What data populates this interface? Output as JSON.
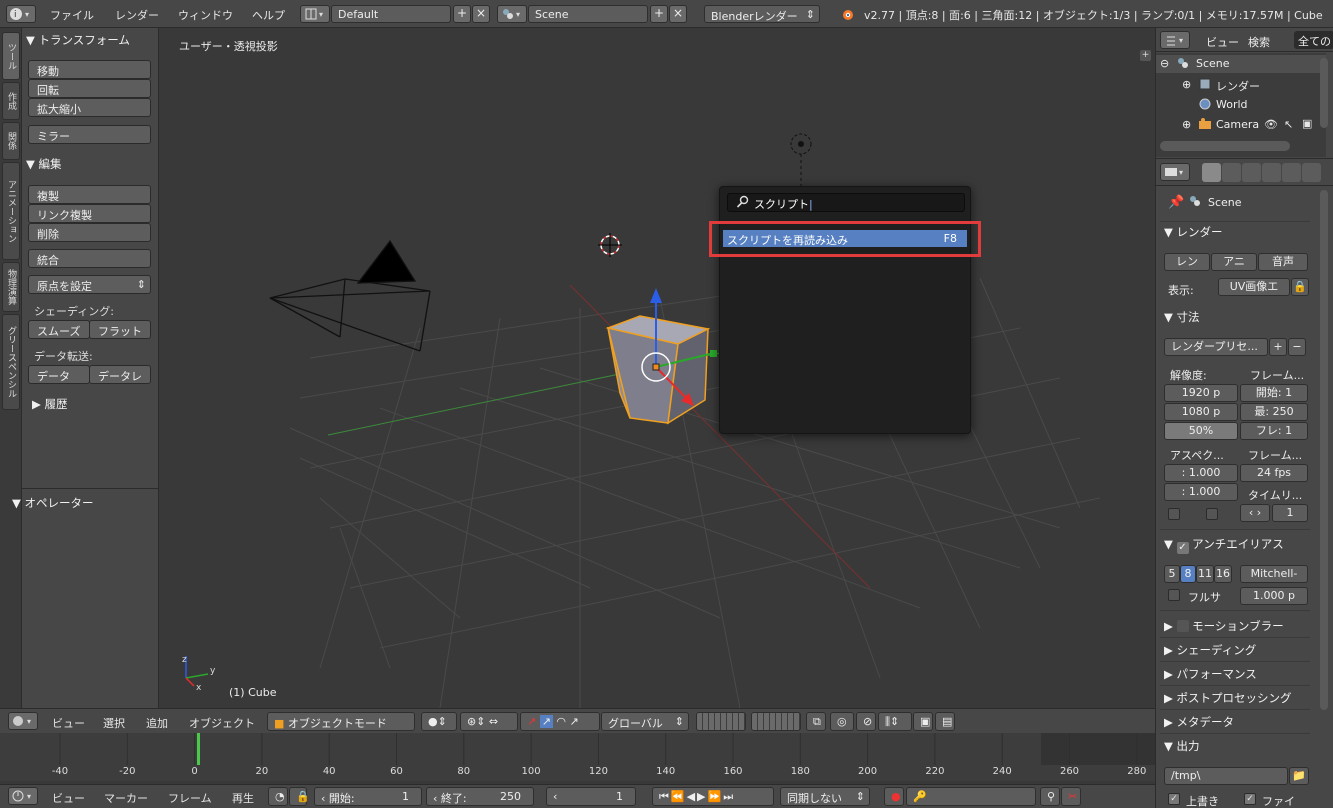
{
  "topbar": {
    "menus": [
      "ファイル",
      "レンダー",
      "ウィンドウ",
      "ヘルプ"
    ],
    "layout": "Default",
    "scene": "Scene",
    "engine": "Blenderレンダー",
    "stats": "v2.77 | 頂点:8 | 面:6 | 三角面:12 | オブジェクト:1/3 | ランプ:0/1 | メモリ:17.57M | Cube"
  },
  "left_tabs": [
    "ツール",
    "作成",
    "関係",
    "アニメーション",
    "物理演算",
    "グリースペンシル"
  ],
  "toolshelf": {
    "transform_header": "▼ トランスフォーム",
    "move": "移動",
    "rotate": "回転",
    "scale": "拡大縮小",
    "mirror": "ミラー",
    "edit_header": "▼ 編集",
    "duplicate": "複製",
    "link_duplicate": "リンク複製",
    "delete": "削除",
    "join": "統合",
    "set_origin": "原点を設定",
    "shading_label": "シェーディング:",
    "smooth": "スムーズ",
    "flat": "フラット",
    "data_transfer_label": "データ転送:",
    "data": "データ",
    "data_layout": "データレ",
    "history_header": "▶ 履歴",
    "operator_header": "▼ オペレーター"
  },
  "viewport": {
    "view_label": "ユーザー・透視投影",
    "object_label": "(1) Cube"
  },
  "popup": {
    "search_text": "スクリプト",
    "item_label": "スクリプトを再読み込み",
    "item_shortcut": "F8"
  },
  "outliner": {
    "view": "ビュー",
    "search": "検索",
    "all": "全ての",
    "items": [
      "Scene",
      "レンダー",
      "World",
      "Camera"
    ]
  },
  "properties": {
    "scene": "Scene",
    "render_header": "▼ レンダー",
    "render_btn": "レン",
    "anim_btn": "アニ",
    "audio_btn": "音声",
    "display_label": "表示:",
    "display_value": "UV画像エ",
    "dimensions_header": "▼ 寸法",
    "preset": "レンダープリセ...",
    "resolution_label": "解像度:",
    "frame_label": "フレーム...",
    "res_x": "1920 p",
    "res_y": "1080 p",
    "res_pct": "50%",
    "frame_start": "開始: 1",
    "frame_end": "最: 250",
    "frame_step": "フレ: 1",
    "aspect_label": "アスペク...",
    "fps_label": "フレーム...",
    "aspect_x": ": 1.000",
    "aspect_y": ": 1.000",
    "fps": "24 fps",
    "time_label": "タイムリ...",
    "time_value": "1",
    "aa_header": "アンチエイリアス",
    "aa_samples": [
      "5",
      "8",
      "11",
      "16"
    ],
    "aa_filter": "Mitchell-",
    "full_sample": "フルサ",
    "filter_size": "1.000 p",
    "motion_blur": "モーションブラー",
    "shading": "▶ シェーディング",
    "performance": "▶ パフォーマンス",
    "post": "▶ ポストプロセッシング",
    "metadata": "▶ メタデータ",
    "output_header": "▼ 出力",
    "output_path": "/tmp\\",
    "overwrite": "上書き",
    "file_ext": "ファイ"
  },
  "vpheader": {
    "view": "ビュー",
    "select": "選択",
    "add": "追加",
    "object": "オブジェクト",
    "mode": "オブジェクトモード",
    "orientation": "グローバル"
  },
  "timeline": {
    "ticks": [
      "-40",
      "-20",
      "0",
      "20",
      "40",
      "60",
      "80",
      "100",
      "120",
      "140",
      "160",
      "180",
      "200",
      "220",
      "240",
      "260",
      "280"
    ]
  },
  "tlheader": {
    "view": "ビュー",
    "marker": "マーカー",
    "frame": "フレーム",
    "playback": "再生",
    "start": "開始:",
    "start_val": "1",
    "end": "終了:",
    "end_val": "250",
    "current": "1",
    "sync": "同期しない"
  }
}
